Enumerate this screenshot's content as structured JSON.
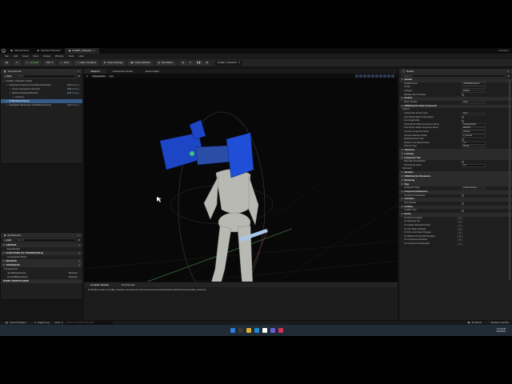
{
  "tabs": [
    {
      "label": "ShooterGame"
    },
    {
      "label": "SandboxCharacter",
      "active": false
    },
    {
      "label": "UnAEP_Character",
      "active": true
    }
  ],
  "window": {
    "title": "UnAEP_Character",
    "right_label": "Character"
  },
  "menu": [
    "File",
    "Edit",
    "Asset",
    "View",
    "Debug",
    "Window",
    "Tools",
    "Help"
  ],
  "toolbar": {
    "compile": "Compile",
    "save": "Save",
    "diff": "Diff",
    "find": "Find",
    "hide_unrelated": "Hide Unrelated",
    "class_settings": "Class Settings",
    "class_defaults": "Class Defaults",
    "simulation": "Simulation",
    "debug_select": "UnAEP_Character"
  },
  "components": {
    "title": "Components",
    "add": "+ Add",
    "search_placeholder": "Search",
    "items": [
      {
        "label": "UnAEP_Character (Self)",
        "indent": 0,
        "edit": ""
      },
      {
        "label": "Capsule Component (CollisionCylinder)",
        "indent": 1,
        "edit": "Edit in C++"
      },
      {
        "label": "Arrow Component (Arrow)",
        "indent": 2,
        "edit": "Edit in C++"
      },
      {
        "label": "Mesh (CharacterMesh0)",
        "indent": 2,
        "edit": "Edit in C++"
      },
      {
        "label": "Camera",
        "indent": 3,
        "edit": ""
      },
      {
        "label": "UNSPARaterSpace",
        "indent": 1,
        "edit": "",
        "selected": true
      },
      {
        "label": "Character Movement (CharMoveComp)",
        "indent": 1,
        "edit": "Edit in C++"
      }
    ]
  },
  "blueprint": {
    "title": "My Blueprint",
    "add": "+ Add",
    "search_placeholder": "Search",
    "sections": [
      {
        "label": "GRAPHS",
        "items": [
          "EventGraph"
        ]
      },
      {
        "label": "FUNCTIONS (21 OVERRIDABLE)",
        "items": [
          "ConstructionScript"
        ]
      },
      {
        "label": "MACROS",
        "items": []
      },
      {
        "label": "VARIABLES",
        "items": []
      }
    ],
    "variables": [
      {
        "label": "Components",
        "type": ""
      },
      {
        "label": "JumpButtonDown",
        "type": "Boolean"
      },
      {
        "label": "CrouchButtonDown",
        "type": "Boolean"
      }
    ],
    "dispatchers": "EVENT DISPATCHERS"
  },
  "viewport": {
    "tabs": [
      "Viewport",
      "Construction Script",
      "Event Graph"
    ],
    "mode": "Perspective",
    "lit": "Lit"
  },
  "compiler": {
    "tabs": [
      "Compiler Results",
      "Find Results"
    ],
    "log": "[1795.95] Compile of UnAEP_Character successful! [in 193 ms] (/Game/ArenaStarterPack/UnAEP/Character/UnAEP_Character)",
    "page": "PAGE",
    "clear": "CLEAR"
  },
  "details": {
    "title": "Details",
    "search_placeholder": "Search",
    "rows": [
      {
        "label": "Variable",
        "kind": "section"
      },
      {
        "label": "Variable Name",
        "value": "UNSPARaterSpace",
        "kind": "field"
      },
      {
        "label": "Tooltip",
        "value": "",
        "kind": "field"
      },
      {
        "label": "Category",
        "value": "Default",
        "kind": "field"
      },
      {
        "label": "Editable when Inherited",
        "kind": "check"
      },
      {
        "label": "Sockets",
        "kind": "section"
      },
      {
        "label": "Parent Socket",
        "value": "None",
        "kind": "field"
      },
      {
        "label": "UNSEOuterSin Pawn Component",
        "kind": "section"
      },
      {
        "label": "Options",
        "kind": "sub"
      },
      {
        "label": "Linked Actor Screen Type",
        "value": "None",
        "kind": "field"
      },
      {
        "label": "Auto Range Select Snap Speed",
        "kind": "check"
      },
      {
        "label": "Use Single Mode",
        "kind": "check"
      },
      {
        "label": "Third Person Mode Component Name",
        "value": "CharacterMesh",
        "kind": "field"
      },
      {
        "label": "First Person Mode Component Name",
        "value": "Mesh1P",
        "kind": "field"
      },
      {
        "label": "Camera Component Name",
        "value": "Camera",
        "kind": "field"
      },
      {
        "label": "Camera Attached Socket",
        "value": "ft_Camera",
        "kind": "field"
      },
      {
        "label": "Replicate Actors Trait",
        "kind": "check"
      },
      {
        "label": "Rotation Line Determination",
        "value": "0.0",
        "kind": "field"
      },
      {
        "label": "Interrupt Type",
        "value": "Simple",
        "kind": "field"
      },
      {
        "label": "Transform",
        "kind": "section"
      },
      {
        "label": "Lowering",
        "kind": "section"
      },
      {
        "label": "Component Tick",
        "kind": "section"
      },
      {
        "label": "Start with Tick Enabled",
        "kind": "check"
      },
      {
        "label": "Tick Interval (secs)",
        "value": "0.0",
        "kind": "field"
      },
      {
        "label": "Advanced",
        "kind": "sub"
      },
      {
        "label": "Variables",
        "kind": "section"
      },
      {
        "label": "UNSEOuterSin Parameters",
        "kind": "section"
      },
      {
        "label": "Rendering",
        "kind": "section"
      },
      {
        "label": "Tags",
        "kind": "section"
      },
      {
        "label": "Component Tags",
        "value": "0 Array element",
        "kind": "field"
      },
      {
        "label": "Component Replication",
        "kind": "section"
      },
      {
        "label": "Component Replicates",
        "kind": "check"
      },
      {
        "label": "Activation",
        "kind": "section"
      },
      {
        "label": "Auto Activate",
        "kind": "check"
      },
      {
        "label": "Cooking",
        "kind": "section"
      },
      {
        "label": "Is Editor Only",
        "kind": "check"
      },
      {
        "label": "Events",
        "kind": "section"
      },
      {
        "label": "On Direct Complete",
        "value": "+",
        "kind": "button"
      },
      {
        "label": "On Spectator Set",
        "value": "+",
        "kind": "button"
      },
      {
        "label": "On Update Selected Trained",
        "value": "+",
        "kind": "button"
      },
      {
        "label": "On Item State Changed",
        "value": "+",
        "kind": "button"
      },
      {
        "label": "On First Look State Changed",
        "value": "+",
        "kind": "button"
      },
      {
        "label": "On Offhand Kit Lift Itself Changed",
        "value": "+",
        "kind": "button"
      },
      {
        "label": "On Component Activated",
        "value": "+",
        "kind": "button"
      },
      {
        "label": "On Component Deactivated",
        "value": "+",
        "kind": "button"
      }
    ]
  },
  "status": {
    "content_drawer": "Content Drawer",
    "output_log": "Output Log",
    "cmd": "Cmd",
    "cmd_placeholder": "Enter Console Command",
    "all_saved": "All Saved",
    "revision": "Revision Control"
  },
  "taskbar": {
    "time": "12:39 AM",
    "date": "5/24/2024",
    "search_placeholder": "Search"
  },
  "colors": {
    "accent": "#365b86",
    "play_green": "#6bd16b",
    "mesh": "#b9b9b4",
    "prop_blue": "#1d46c6"
  }
}
